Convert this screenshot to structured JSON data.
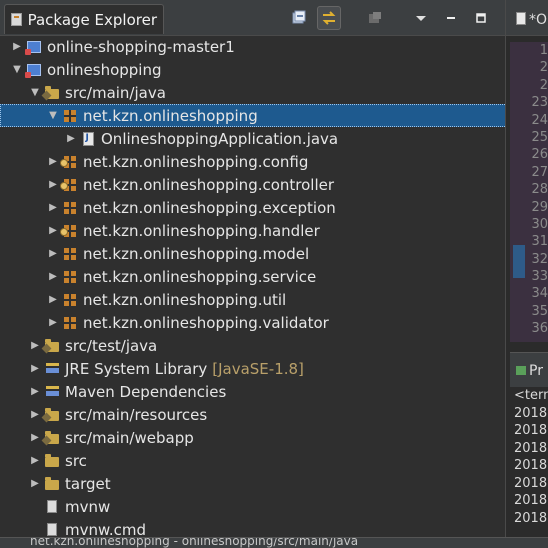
{
  "package_explorer": {
    "title": "Package Explorer",
    "toolbar": [
      {
        "name": "collapse-all",
        "icon": "collapse-all-icon"
      },
      {
        "name": "link-with-editor",
        "icon": "link-with-editor-icon",
        "active": true
      },
      {
        "name": "filters",
        "icon": "filters-icon"
      },
      {
        "name": "view-menu",
        "icon": "view-menu-icon"
      },
      {
        "name": "minimize",
        "icon": "minimize-icon"
      },
      {
        "name": "maximize",
        "icon": "maximize-icon"
      }
    ],
    "tree": [
      {
        "label": "online-shopping-master1",
        "icon": "project-icon",
        "expanded": false,
        "depth": 0
      },
      {
        "label": "onlineshopping",
        "icon": "project-icon",
        "expanded": true,
        "depth": 0
      },
      {
        "label": "src/main/java",
        "icon": "source-folder-icon",
        "expanded": true,
        "depth": 1
      },
      {
        "label": "net.kzn.onlineshopping",
        "icon": "package-icon",
        "expanded": true,
        "depth": 2,
        "selected": true
      },
      {
        "label": "OnlineshoppingApplication.java",
        "icon": "java-file-icon",
        "expanded": false,
        "depth": 3
      },
      {
        "label": "net.kzn.onlineshopping.config",
        "icon": "package-icon",
        "expanded": false,
        "depth": 2
      },
      {
        "label": "net.kzn.onlineshopping.controller",
        "icon": "package-icon",
        "expanded": false,
        "depth": 2
      },
      {
        "label": "net.kzn.onlineshopping.exception",
        "icon": "package-icon",
        "expanded": false,
        "depth": 2
      },
      {
        "label": "net.kzn.onlineshopping.handler",
        "icon": "package-icon",
        "expanded": false,
        "depth": 2
      },
      {
        "label": "net.kzn.onlineshopping.model",
        "icon": "package-icon",
        "expanded": false,
        "depth": 2
      },
      {
        "label": "net.kzn.onlineshopping.service",
        "icon": "package-icon",
        "expanded": false,
        "depth": 2
      },
      {
        "label": "net.kzn.onlineshopping.util",
        "icon": "package-icon",
        "expanded": false,
        "depth": 2
      },
      {
        "label": "net.kzn.onlineshopping.validator",
        "icon": "package-icon",
        "expanded": false,
        "depth": 2
      },
      {
        "label": "src/test/java",
        "icon": "source-folder-icon",
        "expanded": false,
        "depth": 1
      },
      {
        "label": "JRE System Library",
        "decoration": "[JavaSE-1.8]",
        "icon": "library-icon",
        "expanded": false,
        "depth": 1
      },
      {
        "label": "Maven Dependencies",
        "icon": "library-icon",
        "expanded": false,
        "depth": 1
      },
      {
        "label": "src/main/resources",
        "icon": "source-folder-icon",
        "expanded": false,
        "depth": 1
      },
      {
        "label": "src/main/webapp",
        "icon": "source-folder-icon",
        "expanded": false,
        "depth": 1
      },
      {
        "label": "src",
        "icon": "folder-icon",
        "expanded": false,
        "depth": 1
      },
      {
        "label": "target",
        "icon": "folder-icon",
        "expanded": false,
        "depth": 1
      },
      {
        "label": "mvnw",
        "icon": "file-icon",
        "expanded": null,
        "depth": 1
      },
      {
        "label": "mvnw.cmd",
        "icon": "file-icon",
        "expanded": null,
        "depth": 1
      }
    ]
  },
  "editor": {
    "tab_label": "*O",
    "line_numbers": [
      "1",
      "2",
      "2",
      "23",
      "24",
      "25",
      "26",
      "27",
      "28",
      "29",
      "30",
      "31",
      "32",
      "33",
      "34",
      "35",
      "36"
    ]
  },
  "console": {
    "tab_label": "Pr",
    "header": "<term",
    "lines": [
      "2018",
      "2018",
      "2018",
      "2018",
      "2018",
      "2018",
      "2018"
    ]
  },
  "status_bar": {
    "text": "net.kzn.onlineshopping - onlineshopping/src/main/java"
  },
  "colors": {
    "selection": "#1e5a8f",
    "background": "#2f2f2f",
    "decoration_text": "#b9a06a"
  }
}
